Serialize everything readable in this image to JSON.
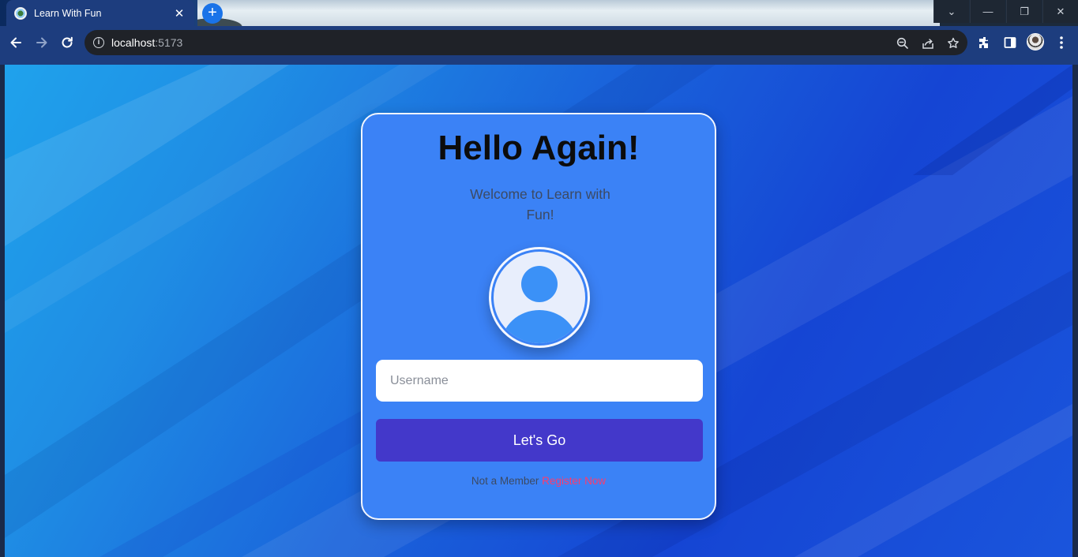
{
  "browser": {
    "tab_title": "Learn With Fun",
    "tab_close": "✕",
    "new_tab": "+",
    "url_host": "localhost",
    "url_port": ":5173",
    "window_controls": {
      "tab_search": "⌄",
      "minimize": "—",
      "restore": "❐",
      "close": "✕"
    }
  },
  "login": {
    "title": "Hello Again!",
    "subtitle": "Welcome to Learn with Fun!",
    "username_placeholder": "Username",
    "submit_label": "Let's Go",
    "member_prompt": "Not a Member",
    "register_label": "Register Now"
  },
  "colors": {
    "card": "#3b82f6",
    "button": "#4338ca",
    "register_link": "#ff3b6b",
    "browser_frame": "#1d3d7e"
  }
}
